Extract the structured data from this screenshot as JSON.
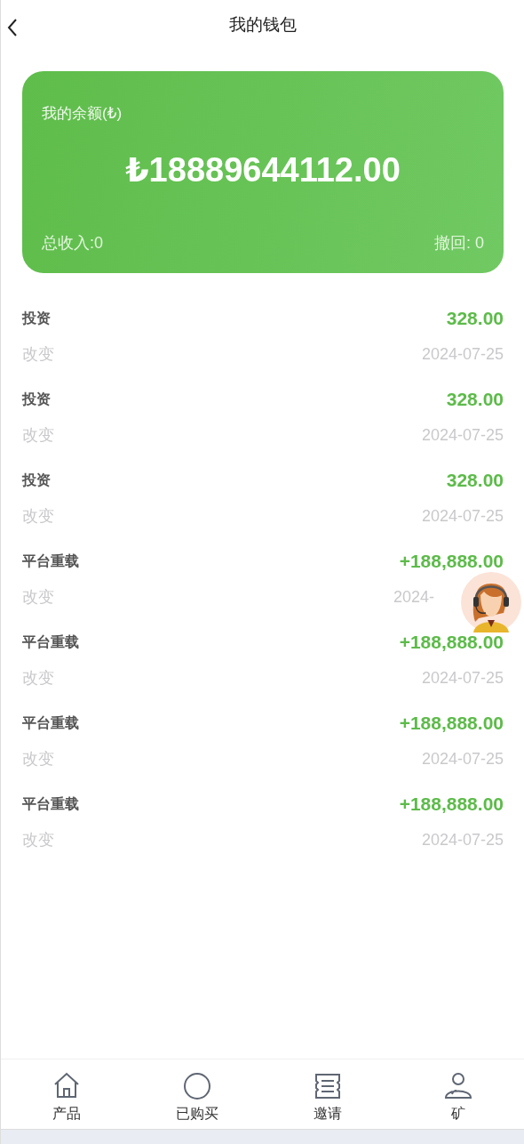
{
  "header": {
    "title": "我的钱包"
  },
  "balance_card": {
    "label": "我的余额(₺)",
    "amount": "₺18889644112.00",
    "total_income": "总收入:0",
    "withdrawn": "撤回: 0"
  },
  "transactions": [
    {
      "title": "投资",
      "amount": "328.00",
      "type": "改变",
      "date": "2024-07-25"
    },
    {
      "title": "投资",
      "amount": "328.00",
      "type": "改变",
      "date": "2024-07-25"
    },
    {
      "title": "投资",
      "amount": "328.00",
      "type": "改变",
      "date": "2024-07-25"
    },
    {
      "title": "平台重载",
      "amount": "+188,888.00",
      "type": "改变",
      "date": "2024-"
    },
    {
      "title": "平台重载",
      "amount": "+188,888.00",
      "type": "改变",
      "date": "2024-07-25"
    },
    {
      "title": "平台重载",
      "amount": "+188,888.00",
      "type": "改变",
      "date": "2024-07-25"
    },
    {
      "title": "平台重载",
      "amount": "+188,888.00",
      "type": "改变",
      "date": "2024-07-25"
    }
  ],
  "bottom_nav": [
    {
      "label": "产品"
    },
    {
      "label": "已购买"
    },
    {
      "label": "邀请"
    },
    {
      "label": "矿"
    }
  ]
}
